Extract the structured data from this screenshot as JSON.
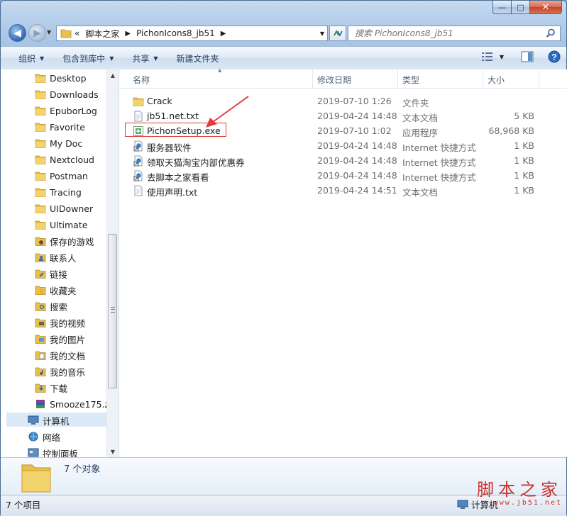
{
  "caption": {
    "minimize": "—",
    "maximize": "□",
    "close": "✕"
  },
  "address": {
    "chevron": "«",
    "crumbs": [
      "脚本之家",
      "PichonIcons8_jb51"
    ]
  },
  "search": {
    "placeholder": "搜索 PichonIcons8_jb51"
  },
  "toolbar": {
    "organize": "组织",
    "include_library": "包含到库中",
    "share": "共享",
    "new_folder": "新建文件夹"
  },
  "nav": {
    "items": [
      {
        "label": "Desktop",
        "icon": "folder-icon"
      },
      {
        "label": "Downloads",
        "icon": "folder-icon"
      },
      {
        "label": "EpuborLog",
        "icon": "folder-icon"
      },
      {
        "label": "Favorite",
        "icon": "folder-icon"
      },
      {
        "label": "My Doc",
        "icon": "folder-icon"
      },
      {
        "label": "Nextcloud",
        "icon": "folder-icon"
      },
      {
        "label": "Postman",
        "icon": "folder-icon"
      },
      {
        "label": "Tracing",
        "icon": "folder-icon"
      },
      {
        "label": "UIDowner",
        "icon": "folder-icon"
      },
      {
        "label": "Ultimate",
        "icon": "folder-icon"
      },
      {
        "label": "保存的游戏",
        "icon": "saved-games-icon"
      },
      {
        "label": "联系人",
        "icon": "contacts-icon"
      },
      {
        "label": "链接",
        "icon": "links-icon"
      },
      {
        "label": "收藏夹",
        "icon": "favorites-icon"
      },
      {
        "label": "搜索",
        "icon": "searches-icon"
      },
      {
        "label": "我的视频",
        "icon": "videos-icon"
      },
      {
        "label": "我的图片",
        "icon": "pictures-icon"
      },
      {
        "label": "我的文档",
        "icon": "documents-icon"
      },
      {
        "label": "我的音乐",
        "icon": "music-icon"
      },
      {
        "label": "下载",
        "icon": "downloads-icon"
      },
      {
        "label": "Smooze175.zi",
        "icon": "archive-icon"
      },
      {
        "label": "计算机",
        "icon": "computer-icon"
      },
      {
        "label": "网络",
        "icon": "network-icon"
      },
      {
        "label": "控制面板",
        "icon": "control-panel-icon"
      }
    ]
  },
  "columns": {
    "name": "名称",
    "date": "修改日期",
    "type": "类型",
    "size": "大小"
  },
  "files": [
    {
      "name": "Crack",
      "date": "2019-07-10 1:26",
      "type": "文件夹",
      "size": "",
      "icon": "folder-icon"
    },
    {
      "name": "jb51.net.txt",
      "date": "2019-04-24 14:48",
      "type": "文本文档",
      "size": "5 KB",
      "icon": "text-file-icon"
    },
    {
      "name": "PichonSetup.exe",
      "date": "2019-07-10 1:02",
      "type": "应用程序",
      "size": "68,968 KB",
      "icon": "exe-icon"
    },
    {
      "name": "服务器软件",
      "date": "2019-04-24 14:48",
      "type": "Internet 快捷方式",
      "size": "1 KB",
      "icon": "url-shortcut-icon"
    },
    {
      "name": "领取天猫淘宝内部优惠券",
      "date": "2019-04-24 14:48",
      "type": "Internet 快捷方式",
      "size": "1 KB",
      "icon": "url-shortcut-icon"
    },
    {
      "name": "去脚本之家看看",
      "date": "2019-04-24 14:48",
      "type": "Internet 快捷方式",
      "size": "1 KB",
      "icon": "url-shortcut-icon"
    },
    {
      "name": "使用声明.txt",
      "date": "2019-04-24 14:51",
      "type": "文本文档",
      "size": "1 KB",
      "icon": "text-file-icon"
    }
  ],
  "details": {
    "count": "7 个对象"
  },
  "status": {
    "items": "7 个项目",
    "location": "计算机"
  },
  "watermark": {
    "text": "脚本之家",
    "url": "www.jb51.net"
  },
  "colors": {
    "highlight_box": "#e23b3b",
    "arrow": "#e23b3b",
    "selection": "#dceaf8"
  }
}
